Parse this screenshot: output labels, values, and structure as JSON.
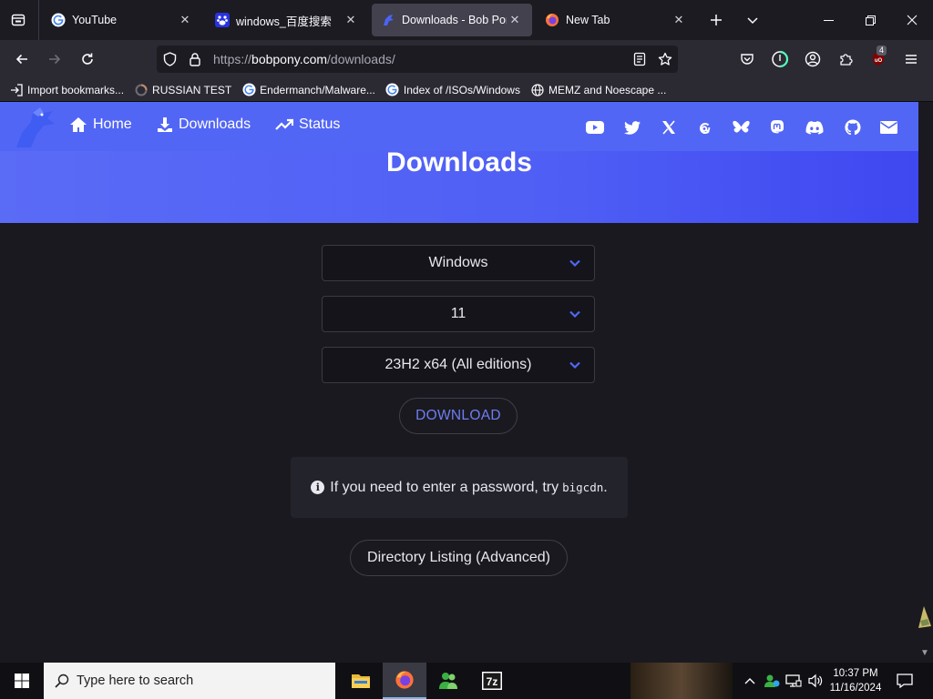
{
  "tabs": [
    {
      "title": "YouTube",
      "favicon": "google-g-icon",
      "selected": false
    },
    {
      "title": "windows_百度搜索",
      "favicon": "baidu-icon",
      "selected": false
    },
    {
      "title": "Downloads - Bob Pony",
      "favicon": "bobpony-icon",
      "selected": true
    },
    {
      "title": "New Tab",
      "favicon": "firefox-icon",
      "selected": false
    }
  ],
  "urlbar": {
    "url_prefix": "https://",
    "url_host": "bobpony.com",
    "url_path": "/downloads/"
  },
  "toolbar": {
    "extension_badge": "4"
  },
  "bookmarks": [
    {
      "label": "Import bookmarks...",
      "icon": "import-icon"
    },
    {
      "label": "RUSSIAN TEST",
      "icon": "loading-icon"
    },
    {
      "label": "Endermanch/Malware...",
      "icon": "google-g-icon"
    },
    {
      "label": "Index of /ISOs/Windows",
      "icon": "google-g-icon"
    },
    {
      "label": "MEMZ and Noescape ...",
      "icon": "globe-icon"
    }
  ],
  "site": {
    "nav": [
      {
        "label": "Home",
        "icon": "home-icon"
      },
      {
        "label": "Downloads",
        "icon": "download-icon"
      },
      {
        "label": "Status",
        "icon": "trending-up-icon"
      }
    ],
    "socials": [
      "youtube-icon",
      "twitter-icon",
      "x-icon",
      "threads-icon",
      "bluesky-icon",
      "mastodon-icon",
      "discord-icon",
      "github-icon",
      "mail-icon"
    ],
    "title": "Downloads"
  },
  "form": {
    "os": "Windows",
    "version": "11",
    "build": "23H2 x64 (All editions)",
    "download_label": "DOWNLOAD"
  },
  "notice": {
    "text": "If you need to enter a password, try",
    "code": "bigcdn",
    "suffix": "."
  },
  "directory_label": "Directory Listing (Advanced)",
  "taskbar": {
    "search_placeholder": "Type here to search",
    "time": "10:37 PM",
    "date": "11/16/2024"
  },
  "colors": {
    "accent": "#5266f5",
    "download_text": "#6f7df5"
  }
}
